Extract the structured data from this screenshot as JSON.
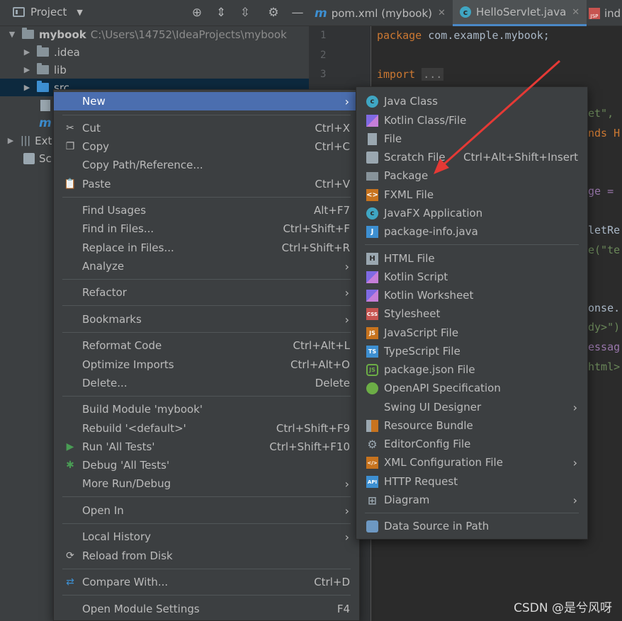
{
  "project_panel": {
    "title": "Project",
    "toolbar_icons": [
      "crosshair-icon",
      "expand-icon",
      "collapse-icon",
      "gear-icon",
      "minimize-icon"
    ],
    "tree": [
      {
        "name": "mybook",
        "path": "C:\\Users\\14752\\IdeaProjects\\mybook"
      },
      {
        "name": ".idea"
      },
      {
        "name": "lib"
      },
      {
        "name": "src"
      },
      {
        "name": "Ext"
      },
      {
        "name": "Sc"
      }
    ]
  },
  "editor": {
    "tabs": [
      {
        "label": "pom.xml (mybook)",
        "icon": "maven-icon"
      },
      {
        "label": "HelloServlet.java",
        "icon": "java-class-icon"
      },
      {
        "label": "ind",
        "icon": "jsp-icon"
      }
    ],
    "line_numbers": [
      "1",
      "2",
      "3"
    ],
    "line1": {
      "keyword": "package",
      "rest": " com.example.mybook;"
    },
    "line3": {
      "keyword": "import",
      "folded": "..."
    },
    "fragments": [
      "et\",",
      "nds H",
      "ge =",
      "letRe",
      "e(\"te",
      "onse.",
      "dy>\")",
      "essag",
      "html>"
    ]
  },
  "context_menu": {
    "items": [
      {
        "label": "New",
        "shortcut": "",
        "submenu": true
      },
      {
        "label": "Cut",
        "shortcut": "Ctrl+X"
      },
      {
        "label": "Copy",
        "shortcut": "Ctrl+C"
      },
      {
        "label": "Copy Path/Reference...",
        "shortcut": ""
      },
      {
        "label": "Paste",
        "shortcut": "Ctrl+V"
      },
      {
        "label": "Find Usages",
        "shortcut": "Alt+F7"
      },
      {
        "label": "Find in Files...",
        "shortcut": "Ctrl+Shift+F"
      },
      {
        "label": "Replace in Files...",
        "shortcut": "Ctrl+Shift+R"
      },
      {
        "label": "Analyze",
        "shortcut": "",
        "submenu": true
      },
      {
        "label": "Refactor",
        "shortcut": "",
        "submenu": true
      },
      {
        "label": "Bookmarks",
        "shortcut": "",
        "submenu": true
      },
      {
        "label": "Reformat Code",
        "shortcut": "Ctrl+Alt+L"
      },
      {
        "label": "Optimize Imports",
        "shortcut": "Ctrl+Alt+O"
      },
      {
        "label": "Delete...",
        "shortcut": "Delete"
      },
      {
        "label": "Build Module 'mybook'",
        "shortcut": ""
      },
      {
        "label": "Rebuild '<default>'",
        "shortcut": "Ctrl+Shift+F9"
      },
      {
        "label": "Run 'All Tests'",
        "shortcut": "Ctrl+Shift+F10"
      },
      {
        "label": "Debug 'All Tests'",
        "shortcut": ""
      },
      {
        "label": "More Run/Debug",
        "shortcut": "",
        "submenu": true
      },
      {
        "label": "Open In",
        "shortcut": "",
        "submenu": true
      },
      {
        "label": "Local History",
        "shortcut": "",
        "submenu": true
      },
      {
        "label": "Reload from Disk",
        "shortcut": ""
      },
      {
        "label": "Compare With...",
        "shortcut": "Ctrl+D"
      },
      {
        "label": "Open Module Settings",
        "shortcut": "F4"
      }
    ]
  },
  "new_submenu": {
    "items": [
      {
        "label": "Java Class",
        "icon": "java-class-icon"
      },
      {
        "label": "Kotlin Class/File",
        "icon": "kotlin-icon"
      },
      {
        "label": "File",
        "icon": "file-icon"
      },
      {
        "label": "Scratch File",
        "shortcut": "Ctrl+Alt+Shift+Insert",
        "icon": "scratch-file-icon"
      },
      {
        "label": "Package",
        "icon": "package-icon"
      },
      {
        "label": "FXML File",
        "icon": "fxml-icon"
      },
      {
        "label": "JavaFX Application",
        "icon": "javafx-icon"
      },
      {
        "label": "package-info.java",
        "icon": "package-info-icon"
      },
      {
        "label": "HTML File",
        "icon": "html-icon"
      },
      {
        "label": "Kotlin Script",
        "icon": "kotlin-script-icon"
      },
      {
        "label": "Kotlin Worksheet",
        "icon": "kotlin-worksheet-icon"
      },
      {
        "label": "Stylesheet",
        "icon": "css-icon"
      },
      {
        "label": "JavaScript File",
        "icon": "js-icon"
      },
      {
        "label": "TypeScript File",
        "icon": "ts-icon"
      },
      {
        "label": "package.json File",
        "icon": "nodejs-icon"
      },
      {
        "label": "OpenAPI Specification",
        "icon": "openapi-icon"
      },
      {
        "label": "Swing UI Designer",
        "submenu": true
      },
      {
        "label": "Resource Bundle",
        "icon": "resource-bundle-icon"
      },
      {
        "label": "EditorConfig File",
        "icon": "gear-icon"
      },
      {
        "label": "XML Configuration File",
        "icon": "xml-icon",
        "submenu": true
      },
      {
        "label": "HTTP Request",
        "icon": "api-icon"
      },
      {
        "label": "Diagram",
        "icon": "diagram-icon",
        "submenu": true
      },
      {
        "label": "Data Source in Path",
        "icon": "database-icon"
      }
    ]
  },
  "annotation_color": "#e53935",
  "watermark": "CSDN @是兮风呀"
}
